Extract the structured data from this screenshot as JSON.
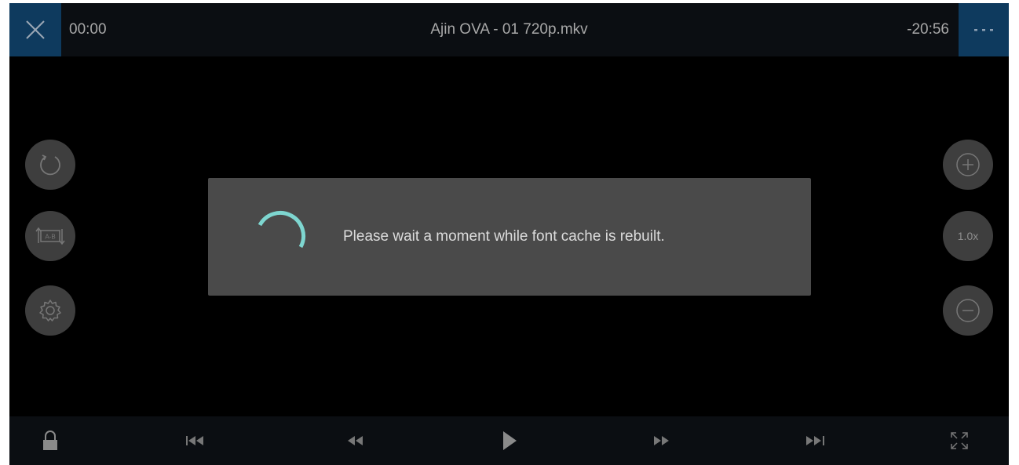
{
  "header": {
    "elapsed": "00:00",
    "title": "Ajin OVA - 01 720p.mkv",
    "remaining": "-20:56"
  },
  "side_controls": {
    "speed_label": "1.0x"
  },
  "dialog": {
    "message": "Please wait a moment while font cache is rebuilt."
  },
  "colors": {
    "accent_button": "#0e3a5e",
    "spinner": "#7ed6d0",
    "dialog_bg": "#4a4a4a"
  },
  "icons": {
    "close": "close-icon",
    "more": "more-icon",
    "rotate": "rotate-icon",
    "ab_repeat": "ab-repeat-icon",
    "settings": "gear-icon",
    "zoom_in": "zoom-in-icon",
    "zoom_out": "zoom-out-icon",
    "lock": "lock-icon",
    "previous": "skip-previous-icon",
    "rewind": "rewind-icon",
    "play": "play-icon",
    "forward": "fast-forward-icon",
    "next": "skip-next-icon",
    "fullscreen": "fullscreen-icon"
  }
}
